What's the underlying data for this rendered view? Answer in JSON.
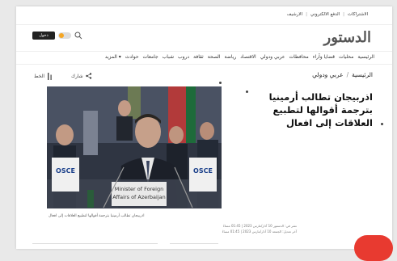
{
  "topbar": {
    "links": [
      "الاشتراكات",
      "الدفع الالكتروني",
      "الارشيف"
    ]
  },
  "logo": {
    "text": "الدستور"
  },
  "header": {
    "login_label": "دخول"
  },
  "nav": {
    "items": [
      "الرئيسية",
      "محليات",
      "قضايا وآراء",
      "محافظات",
      "عربي ودولي",
      "الاقتصاد",
      "رياضة",
      "الصحة",
      "ثقافة",
      "دروب",
      "شباب",
      "جامعات",
      "حوادث",
      "المزيد"
    ]
  },
  "breadcrumb": {
    "home": "الرئيسية",
    "section": "عربي ودولي"
  },
  "actions": {
    "share_label": "شارك",
    "font_label": "الخط"
  },
  "article": {
    "headline": "اذربيجان تطالب أرمينيا بترجمة أقوالها لتطبيع العلاقات إلى افعال",
    "photo_overlay": [
      "Minister of Foreign",
      "Affairs of Azerbaijan"
    ],
    "photo_sign": "OSCE",
    "caption": "اذربيجان تطالب أرمينيا بترجمة أقوالها لتطبيع العلاقات إلى افعال",
    "meta_published": "نشر في: الدستور 10 آذار/مارس 2023 | 01:45 مساءً",
    "meta_updated": "آخر تعديل: الجمعة 10 آذار/مارس 2023 | 01:45 مساءً"
  },
  "colors": {
    "brand_red": "#c8102e",
    "accent_orange": "#f5a623"
  }
}
